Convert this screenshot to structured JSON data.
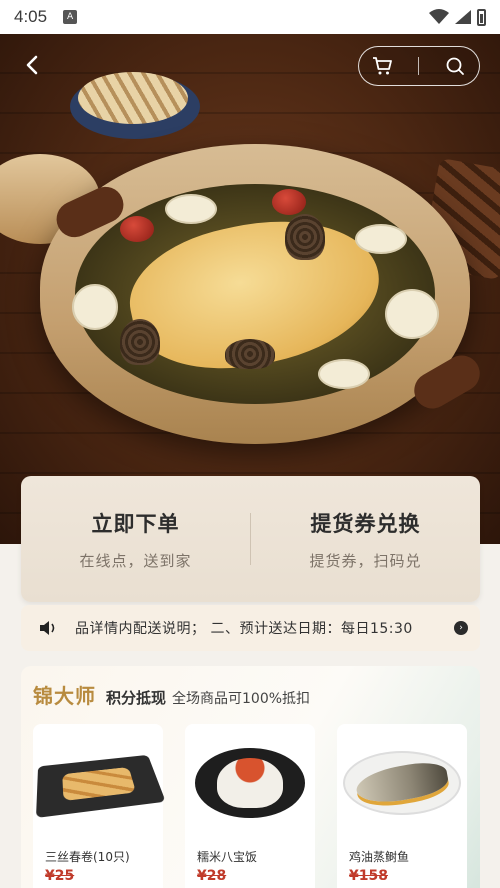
{
  "status_bar": {
    "time": "4:05",
    "app_icon": "A"
  },
  "hero": {
    "icons": [
      "back-icon",
      "cart-icon",
      "search-icon"
    ]
  },
  "order": {
    "order_now": {
      "title": "立即下单",
      "subtitle": "在线点，送到家"
    },
    "voucher": {
      "title": "提货券兑换",
      "subtitle": "提货券，扫码兑"
    }
  },
  "notice": {
    "text": "品详情内配送说明；  二、预计送达日期：每日15:30"
  },
  "promo": {
    "brand": "锦大师",
    "title": "积分抵现",
    "subtitle": "全场商品可100%抵扣",
    "products": [
      {
        "name": "三丝春卷(10只)",
        "price": "¥25"
      },
      {
        "name": "糯米八宝饭",
        "price": "¥28"
      },
      {
        "name": "鸡油蒸鲥鱼",
        "price": "¥158"
      }
    ]
  },
  "colors": {
    "brand_gold": "#b88b3f",
    "price_red": "#c03b2b",
    "card_bg": "#efe6da"
  }
}
